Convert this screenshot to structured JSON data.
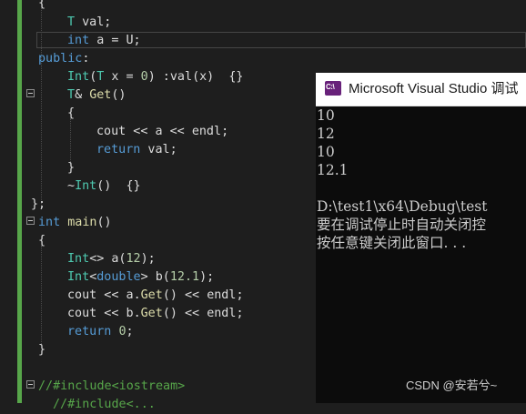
{
  "editor": {
    "l0": {
      "a": "{"
    },
    "l1": {
      "a": "T",
      "b": " val;"
    },
    "l2": {
      "a": "int",
      "b": " a = U;"
    },
    "l3": {
      "a": "public",
      "b": ":"
    },
    "l4": {
      "a": "Int",
      "b": "(",
      "c": "T",
      "d": " x = ",
      "e": "0",
      "f": ") :",
      "g": "val",
      "h": "(x)  {}"
    },
    "l5": {
      "a": "T",
      "b": "& ",
      "c": "Get",
      "d": "()"
    },
    "l6": {
      "a": "{"
    },
    "l7": {
      "a": "cout",
      "b": " << ",
      "c": "a",
      "d": " << ",
      "e": "endl",
      "f": ";"
    },
    "l8": {
      "a": "return",
      "b": " val;"
    },
    "l9": {
      "a": "}"
    },
    "l10": {
      "a": "~",
      "b": "Int",
      "c": "()  {}"
    },
    "l11": {
      "a": "};"
    },
    "l12": {
      "a": "int",
      "b": " ",
      "c": "main",
      "d": "()"
    },
    "l13": {
      "a": "{"
    },
    "l14": {
      "a": "Int",
      "b": "<> a(",
      "c": "12",
      "d": ");"
    },
    "l15": {
      "a": "Int",
      "b": "<",
      "c": "double",
      "d": "> b(",
      "e": "12.1",
      "f": ");"
    },
    "l16": {
      "a": "cout",
      "b": " << ",
      "c": "a",
      "d": ".",
      "e": "Get",
      "f": "() << ",
      "g": "endl",
      "h": ";"
    },
    "l17": {
      "a": "cout",
      "b": " << ",
      "c": "b",
      "d": ".",
      "e": "Get",
      "f": "() << ",
      "g": "endl",
      "h": ";"
    },
    "l18": {
      "a": "return",
      "b": " ",
      "c": "0",
      "d": ";"
    },
    "l19": {
      "a": "}"
    },
    "l20": {
      "a": "//#include<iostream>"
    },
    "l21": {
      "a": "//#include<..."
    }
  },
  "console": {
    "title": "Microsoft Visual Studio 调试",
    "icon_text": "C:\\",
    "lines": [
      "10",
      "12",
      "10",
      "12.1",
      "",
      "D:\\test1\\x64\\Debug\\test",
      "要在调试停止时自动关闭控",
      "按任意键关闭此窗口. . ."
    ]
  },
  "watermark": "CSDN @安若兮~",
  "colors": {
    "keyword": "#569cd6",
    "type": "#4ec9b0",
    "function": "#dcdcaa",
    "number": "#b5cea8",
    "comment": "#57a64a",
    "editor_bg": "#1e1e1e",
    "console_bg": "#0c0c0c",
    "change_bar": "#57a64a",
    "vs_icon": "#68217a"
  }
}
